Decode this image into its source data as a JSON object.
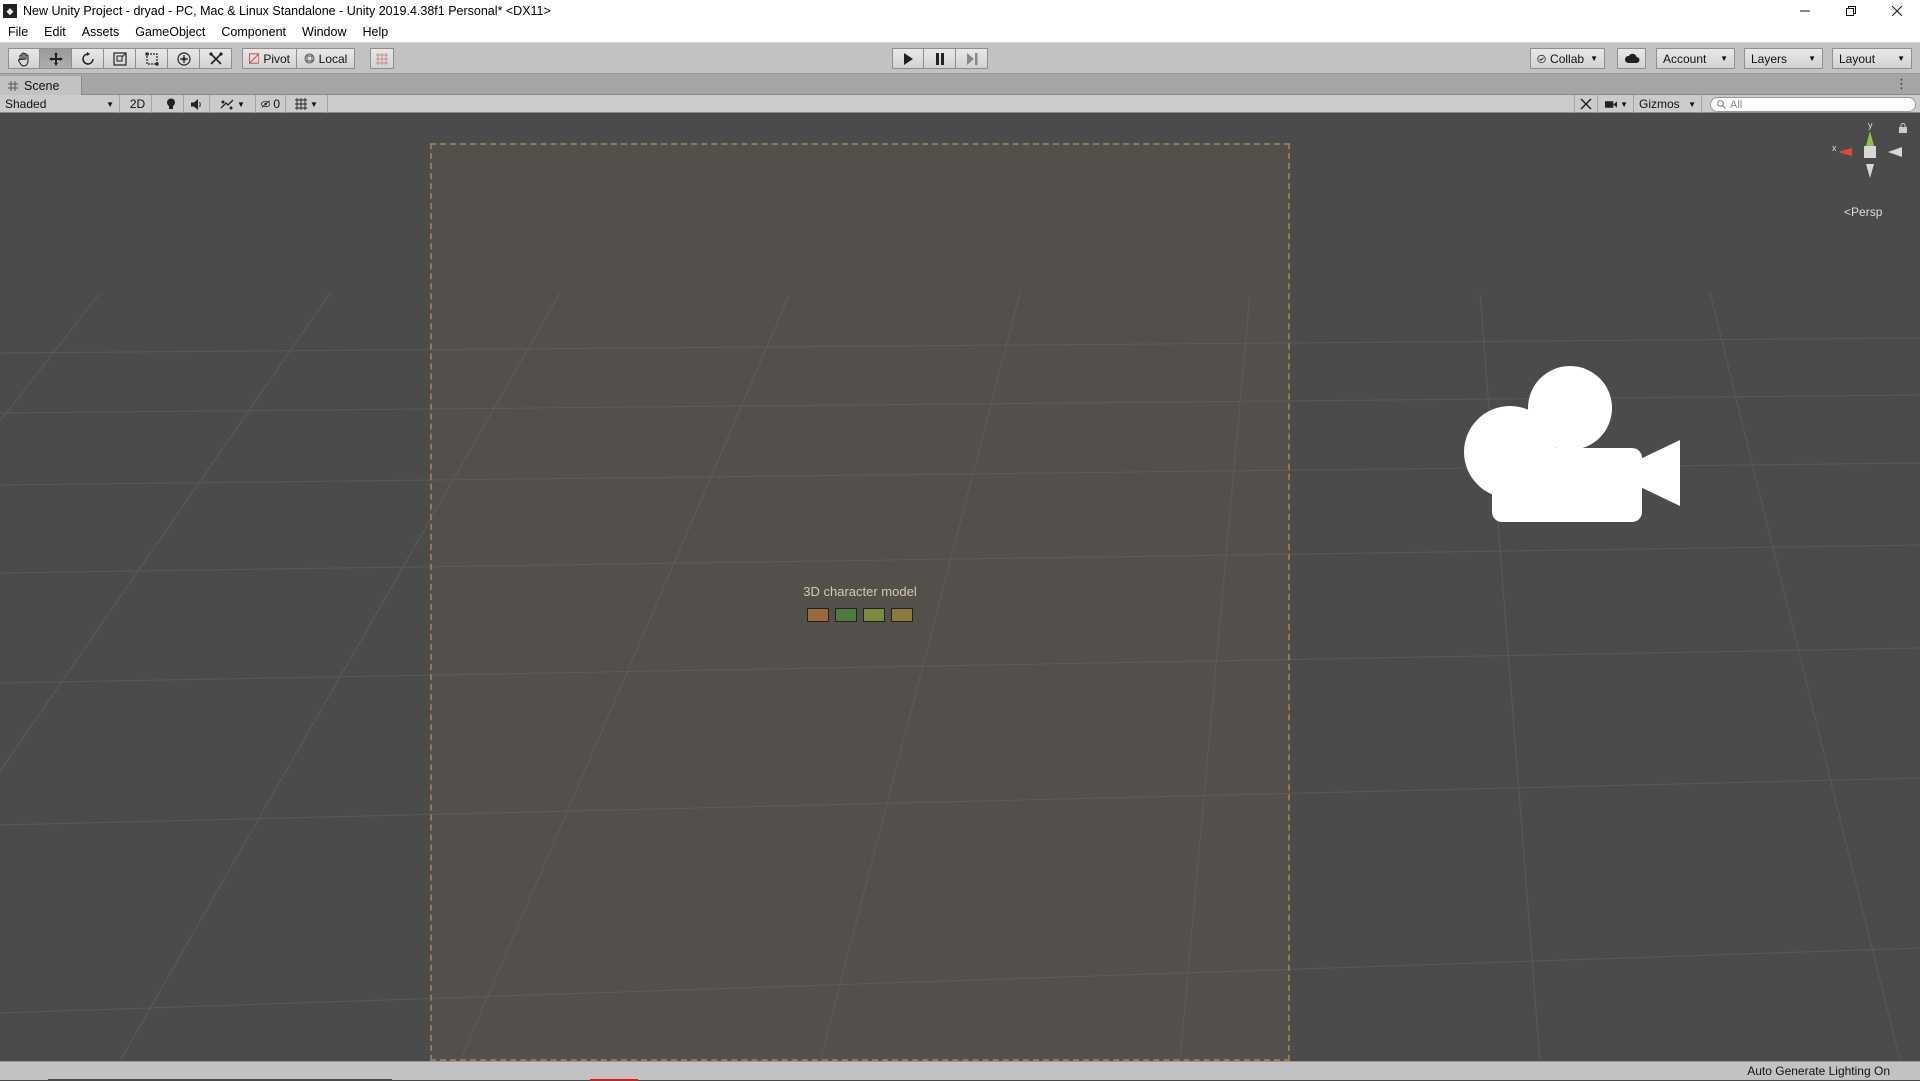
{
  "window": {
    "title": "New Unity Project - dryad - PC, Mac & Linux Standalone - Unity 2019.4.38f1 Personal* <DX11>",
    "app_icon": "unity-icon",
    "controls": [
      "minimize-icon",
      "restore-icon",
      "close-icon"
    ]
  },
  "menu": {
    "items": [
      "File",
      "Edit",
      "Assets",
      "GameObject",
      "Component",
      "Window",
      "Help"
    ]
  },
  "toolbar": {
    "tools": [
      {
        "name": "hand-tool",
        "icon": "hand-icon"
      },
      {
        "name": "move-tool",
        "icon": "move-icon",
        "active": true
      },
      {
        "name": "rotate-tool",
        "icon": "rotate-icon"
      },
      {
        "name": "scale-tool",
        "icon": "scale-icon"
      },
      {
        "name": "rect-tool",
        "icon": "rect-icon"
      },
      {
        "name": "transform-tool",
        "icon": "transform-icon"
      },
      {
        "name": "custom-tool",
        "icon": "custom-tools-icon"
      }
    ],
    "pivot_label": "Pivot",
    "local_label": "Local",
    "snap_icon": "grid-snap-icon",
    "play_icons": [
      "play-icon",
      "pause-icon",
      "step-icon"
    ],
    "collab_label": "Collab",
    "cloud_icon": "cloud-icon",
    "account_label": "Account",
    "layers_label": "Layers",
    "layout_label": "Layout"
  },
  "scene_tab": {
    "label": "Scene",
    "icon": "scene-grid-icon"
  },
  "scene_toolbar": {
    "draw_mode": "Shaded",
    "mode_2d": "2D",
    "hidden_count": "0",
    "gizmos_label": "Gizmos",
    "search_placeholder": "All"
  },
  "viewport": {
    "orientation": {
      "y_label": "y",
      "x_label": "x",
      "projection": "Persp"
    },
    "character_placeholder": "3D character model",
    "character_colors": {
      "skin": "#9a6a3a",
      "cloth": "#4f7a3e",
      "hair": "#7a8a3e",
      "horn": "#8a7a3e"
    },
    "camera_gizmo_icon": "camera-gizmo-icon"
  },
  "status": {
    "text": "Auto Generate Lighting On"
  }
}
